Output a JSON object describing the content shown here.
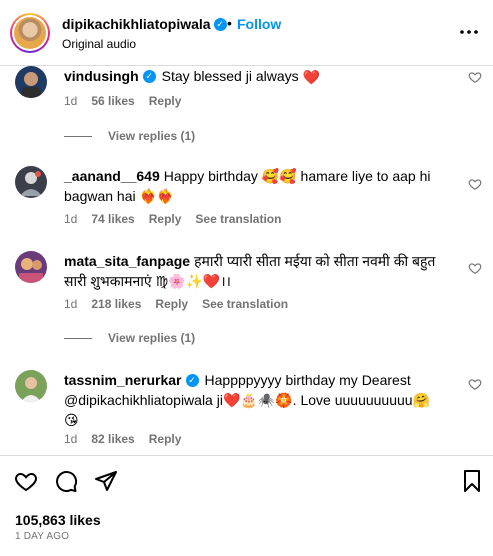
{
  "header": {
    "username": "dipikachikhliatopiwala",
    "dot": "•",
    "follow_label": "Follow",
    "audio": "Original audio"
  },
  "comments": [
    {
      "user": "vindusingh",
      "verified": true,
      "text": "Stay blessed ji always",
      "emoji": "❤️",
      "age": "1d",
      "likes": "56 likes",
      "reply": "Reply",
      "view_replies": "View replies (1)"
    },
    {
      "user": "_aanand__649",
      "verified": false,
      "text": "Happy birthday 🥰🥰 hamare liye to aap hi bagwan hai ❤️‍🔥❤️‍🔥",
      "age": "1d",
      "likes": "74 likes",
      "reply": "Reply",
      "translation": "See translation"
    },
    {
      "user": "mata_sita_fanpage",
      "verified": false,
      "text": "हमारी प्यारी सीता मईया को सीता नवमी की बहुत सारी शुभकामनाएं ♍🌸✨❤️।।",
      "age": "1d",
      "likes": "218 likes",
      "reply": "Reply",
      "translation": "See translation",
      "view_replies": "View replies (1)"
    },
    {
      "user": "tassnim_nerurkar",
      "verified": true,
      "text": "Happppyyyy birthday my Dearest @dipikachikhliatopiwala ji❤️🎂🕷️🏵️. Love uuuuuuuuuu🤗 😘",
      "age": "1d",
      "likes": "82 likes",
      "reply": "Reply"
    }
  ],
  "footer": {
    "likes": "105,863 likes",
    "time": "1 DAY AGO"
  },
  "colors": {
    "accent": "#0095f6",
    "muted": "#737373",
    "heart": "#ed4956"
  },
  "icons": [
    "more-icon",
    "heart-icon",
    "comment-icon",
    "share-icon",
    "save-icon",
    "verified-icon"
  ]
}
